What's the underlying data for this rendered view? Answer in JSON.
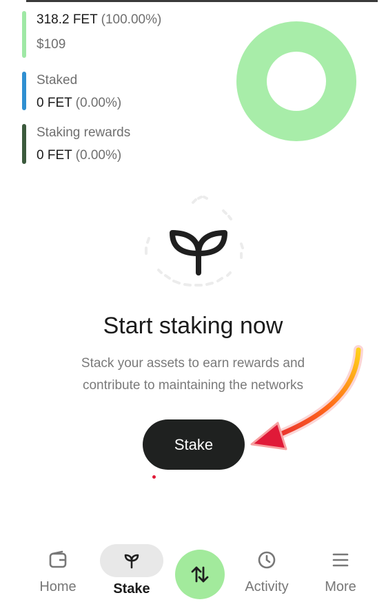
{
  "balance": {
    "available": {
      "amount": "318.2 FET",
      "percent": "(100.00%)",
      "usd": "$109",
      "color": "#9fe8a5"
    },
    "staked": {
      "label": "Staked",
      "amount": "0 FET",
      "percent": "(0.00%)",
      "color": "#2f8fd1"
    },
    "rewards": {
      "label": "Staking rewards",
      "amount": "0 FET",
      "percent": "(0.00%)",
      "color": "#3b5a3c"
    }
  },
  "donut": {
    "available_fraction": 1.0,
    "color": "#a8eda9"
  },
  "hero": {
    "icon": "sprout-icon",
    "title": "Start staking now",
    "subtitle_line1": "Stack your assets to earn rewards and",
    "subtitle_line2": "contribute to maintaining the networks"
  },
  "stake_button": {
    "label": "Stake"
  },
  "nav": {
    "items": [
      {
        "label": "Home",
        "icon": "wallet-icon",
        "active": false
      },
      {
        "label": "Stake",
        "icon": "sprout-icon",
        "active": true
      },
      {
        "label": "Activity",
        "icon": "clock-icon",
        "active": false
      },
      {
        "label": "More",
        "icon": "menu-icon",
        "active": false
      }
    ],
    "center_action": {
      "icon": "swap-arrows-icon",
      "color": "#a2ea9c"
    }
  },
  "colors": {
    "accent": "#a2ea9c",
    "button_dark": "#1f2120",
    "annotation_arrow": "#e01a38"
  }
}
